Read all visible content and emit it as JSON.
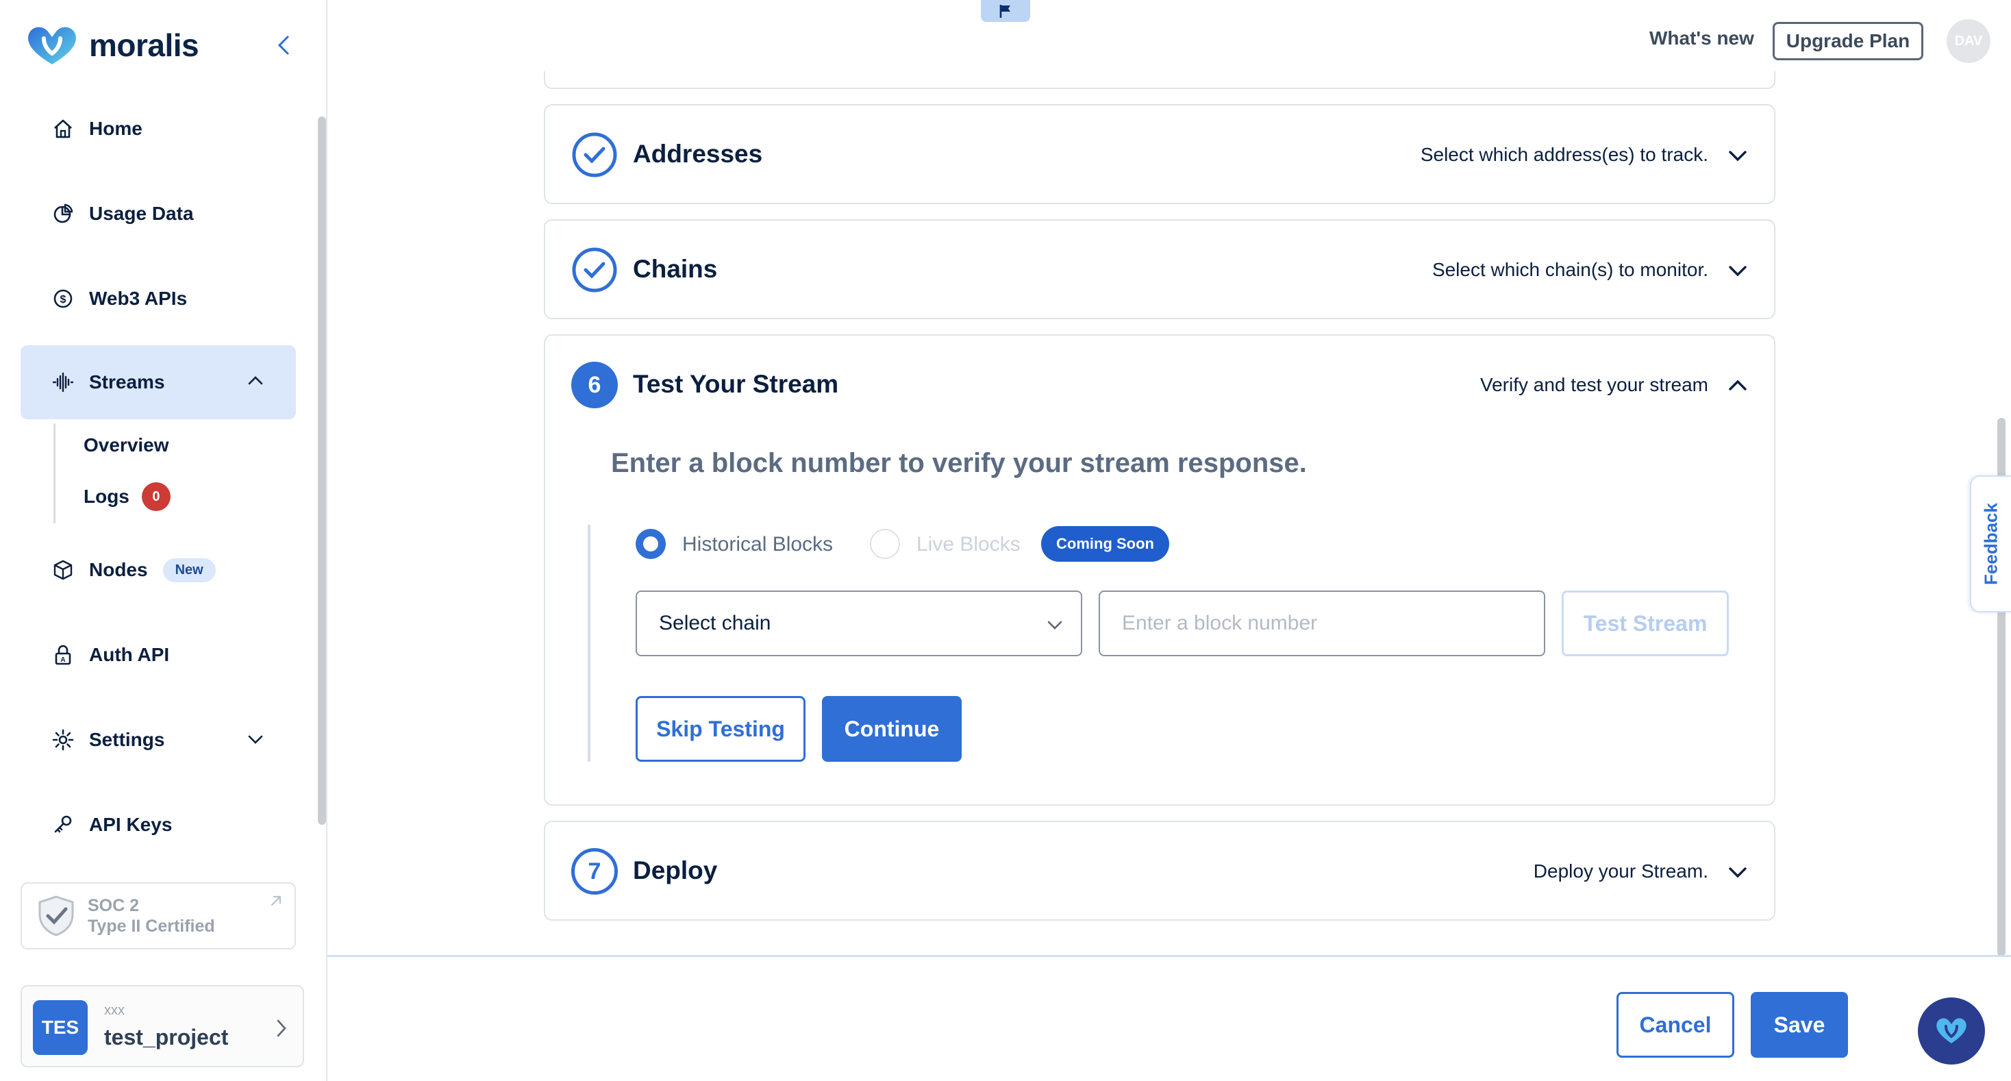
{
  "brand": {
    "name": "moralis"
  },
  "sidebar": {
    "items": [
      {
        "label": "Home"
      },
      {
        "label": "Usage Data"
      },
      {
        "label": "Web3 APIs"
      },
      {
        "label": "Streams"
      },
      {
        "label": "Nodes",
        "badge": "New"
      },
      {
        "label": "Auth API"
      },
      {
        "label": "Settings"
      },
      {
        "label": "API Keys"
      }
    ],
    "streams_sub": [
      {
        "label": "Overview"
      },
      {
        "label": "Logs",
        "count": "0"
      }
    ],
    "soc": {
      "line1": "SOC 2",
      "line2": "Type II Certified"
    },
    "project": {
      "avatar": "TES",
      "org": "xxx",
      "name": "test_project"
    }
  },
  "topbar": {
    "whats_new": "What's new",
    "upgrade": "Upgrade Plan",
    "avatar": "DAV"
  },
  "steps": [
    {
      "title": "Addresses",
      "description": "Select which address(es) to track.",
      "state": "done"
    },
    {
      "title": "Chains",
      "description": "Select which chain(s) to monitor.",
      "state": "done"
    },
    {
      "number": "6",
      "title": "Test Your Stream",
      "description": "Verify and test your stream",
      "state": "open"
    },
    {
      "number": "7",
      "title": "Deploy",
      "description": "Deploy your Stream.",
      "state": "pending"
    }
  ],
  "test_panel": {
    "heading": "Enter a block number to verify your stream response.",
    "radio_historical": "Historical Blocks",
    "radio_live": "Live Blocks",
    "coming_soon": "Coming Soon",
    "select_chain": "Select chain",
    "block_placeholder": "Enter a block number",
    "test_button": "Test Stream",
    "skip_button": "Skip Testing",
    "continue_button": "Continue"
  },
  "feedback": "Feedback",
  "footer": {
    "cancel": "Cancel",
    "save": "Save"
  },
  "colors": {
    "primary": "#2f6fd6",
    "active_bg": "#dbe7fa",
    "danger": "#cc3b35"
  }
}
